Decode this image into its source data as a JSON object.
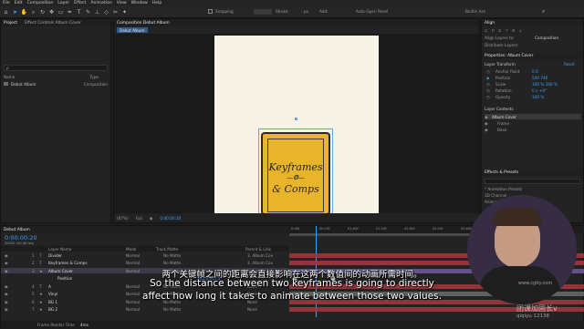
{
  "menu": [
    "File",
    "Edit",
    "Composition",
    "Layer",
    "Effect",
    "Animation",
    "View",
    "Window",
    "Help"
  ],
  "toolbar": {
    "snapping": "Snapping",
    "stroke_label": "Stroke:",
    "stroke_value": "- px",
    "add_label": "Add:",
    "auto_open": "Auto-Open Panel",
    "workspace": "Builtin Ass"
  },
  "project_panel": {
    "tab_project": "Project",
    "tab_effects": "Effect Controls Album Cover",
    "search_placeholder": "ρ",
    "col_name": "Name",
    "col_type": "Type",
    "item_name": "Debut Album",
    "item_type": "Composition"
  },
  "comp_panel": {
    "tab": "Composition Debut Album",
    "breadcrumb": "Debut Album",
    "zoom": "(67%)",
    "quality": "Full",
    "timecode": "0:00:00:20"
  },
  "artwork": {
    "line1": "Keyframes",
    "line2": "& Comps",
    "bg_color": "#f7f3e6",
    "card_color": "#e8b42a"
  },
  "right_panel": {
    "align_tab": "Align",
    "align_to_label": "Align Layers to:",
    "align_to_value": "Composition",
    "distribute_label": "Distribute Layers:",
    "properties_tab": "Properties: Album Cover",
    "layer_transform": "Layer Transform",
    "reset": "Reset",
    "props": [
      {
        "name": "Anchor Point",
        "value": "0    0"
      },
      {
        "name": "Position",
        "value": "540    740"
      },
      {
        "name": "Scale",
        "value": "100 %    100 %"
      },
      {
        "name": "Rotation",
        "value": "0 x +0°"
      },
      {
        "name": "Opacity",
        "value": "100 %"
      }
    ],
    "layer_contents": "Layer Contents",
    "contents": [
      "Album Cover",
      "Frame",
      "Base"
    ],
    "effects_tab": "Effects & Presets",
    "effects": [
      "* Animation Presets",
      "3D Channel",
      "Animatable"
    ]
  },
  "timeline": {
    "tab": "Debut Album",
    "timecode": "0:00:00:20",
    "frames": "00020 (30.00 fps)",
    "col_layer": "Layer Name",
    "col_mode": "Mode",
    "col_trkmat": "Track Matte",
    "col_parent": "Parent & Link",
    "layers": [
      {
        "num": "1",
        "type": "T",
        "name": "Divider",
        "mode": "Normal",
        "matte": "No Matte",
        "parent": "3. Album Cov"
      },
      {
        "num": "2",
        "type": "T",
        "name": "Keyframes & Comps",
        "mode": "Normal",
        "matte": "No Matte",
        "parent": "3. Album Cov"
      },
      {
        "num": "3",
        "type": "★",
        "name": "Album Cover",
        "mode": "Normal",
        "matte": "No Matte",
        "parent": "None"
      },
      {
        "num": "",
        "type": "",
        "name": "Position",
        "mode": "",
        "matte": "",
        "parent": "",
        "value": "540.0,917.5"
      },
      {
        "num": "4",
        "type": "T",
        "name": "A",
        "mode": "Normal",
        "matte": "No Matte",
        "parent": "None"
      },
      {
        "num": "5",
        "type": "★",
        "name": "Vinyl",
        "mode": "Normal",
        "matte": "No Matte",
        "parent": "None"
      },
      {
        "num": "6",
        "type": "★",
        "name": "BG 1",
        "mode": "Normal",
        "matte": "No Matte",
        "parent": "None"
      },
      {
        "num": "7",
        "type": "★",
        "name": "BG 2",
        "mode": "Normal",
        "matte": "No Matte",
        "parent": "None"
      }
    ],
    "ruler": [
      "0:00f",
      "00:15f",
      "01:00f",
      "01:15f",
      "02:00f",
      "02:15f",
      "03:00f",
      "03:15f",
      "04:00f",
      "04:15f"
    ],
    "render_time_label": "Frame Render Time",
    "render_time_value": "4ms"
  },
  "subtitles": {
    "zh": "两个关键帧之间的距离会直接影响在这两个数值间的动画所需时间。",
    "en1": "So the distance between two keyframes is going to directly",
    "en2": "affect how long it takes to animate between those two values."
  },
  "watermark": {
    "site": "www.cgtiy.com",
    "brand": "团课加固长v",
    "id": "qiqiyu 12138"
  },
  "colors": {
    "accent": "#3ca0ff",
    "layer_red": "#a4383f",
    "layer_purple": "#6c5a9e",
    "layer_gray": "#6b6b6b"
  }
}
